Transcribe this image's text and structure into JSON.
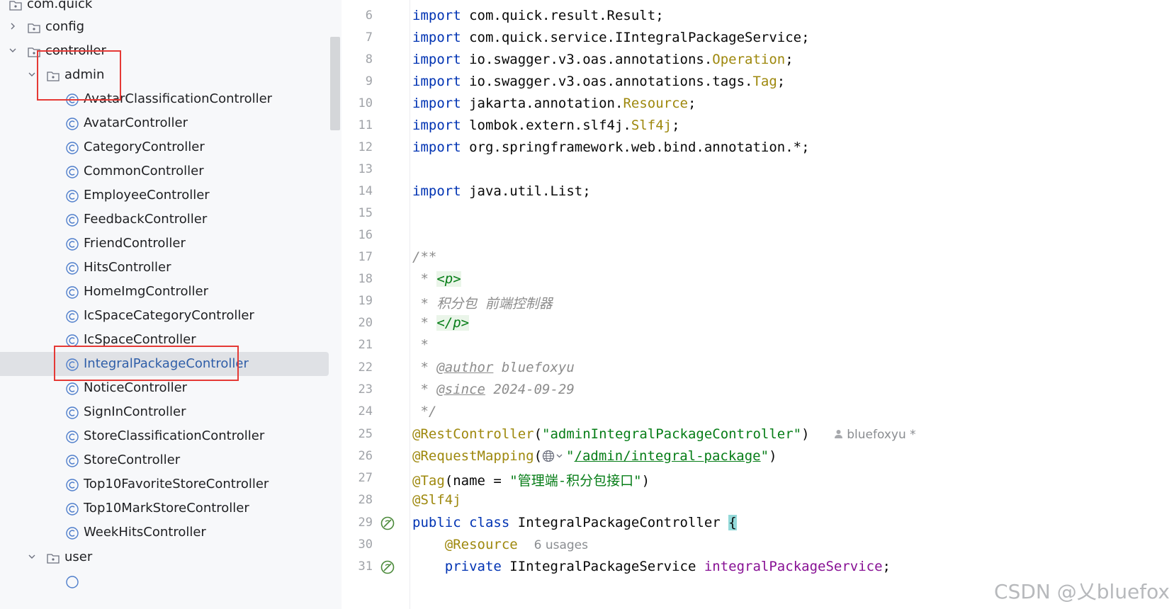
{
  "tree": {
    "rows": [
      {
        "label": "com.quick"
      },
      {
        "label": "config"
      },
      {
        "label": "controller"
      },
      {
        "label": "admin"
      },
      {
        "label": "AvatarClassificationController"
      },
      {
        "label": "AvatarController"
      },
      {
        "label": "CategoryController"
      },
      {
        "label": "CommonController"
      },
      {
        "label": "EmployeeController"
      },
      {
        "label": "FeedbackController"
      },
      {
        "label": "FriendController"
      },
      {
        "label": "HitsController"
      },
      {
        "label": "HomeImgController"
      },
      {
        "label": "IcSpaceCategoryController"
      },
      {
        "label": "IcSpaceController"
      },
      {
        "label": "IntegralPackageController"
      },
      {
        "label": "NoticeController"
      },
      {
        "label": "SignInController"
      },
      {
        "label": "StoreClassificationController"
      },
      {
        "label": "StoreController"
      },
      {
        "label": "Top10FavoriteStoreController"
      },
      {
        "label": "Top10MarkStoreController"
      },
      {
        "label": "WeekHitsController"
      },
      {
        "label": "user"
      }
    ],
    "selected_label": "IntegralPackageController"
  },
  "editor": {
    "line_numbers": [
      "6",
      "7",
      "8",
      "9",
      "10",
      "11",
      "12",
      "13",
      "14",
      "15",
      "16",
      "17",
      "18",
      "19",
      "20",
      "21",
      "22",
      "23",
      "24",
      "25",
      "26",
      "27",
      "28",
      "29",
      "30",
      "31"
    ],
    "kw_import": "import",
    "l6": "com.quick.result.Result;",
    "l7": "com.quick.service.IIntegralPackageService;",
    "l8_pre": "io.swagger.v3.oas.annotations.",
    "l8_cls": "Operation",
    "l9_pre": "io.swagger.v3.oas.annotations.tags.",
    "l9_cls": "Tag",
    "l10_pre": "jakarta.annotation.",
    "l10_cls": "Resource",
    "l11_pre": "lombok.extern.slf4j.",
    "l11_cls": "Slf4j",
    "l12": "org.springframework.web.bind.annotation.*;",
    "l14": "java.util.List;",
    "l17": "/**",
    "star": " * ",
    "p_open": "<p>",
    "l19_text": "积分包 前端控制器",
    "p_close": "</p>",
    "l21": " *",
    "author_tag": "@author",
    "author_val": " bluefoxyu",
    "since_tag": "@since",
    "since_val": " 2024-09-29",
    "l24": " */",
    "l25_ann": "@RestController",
    "l25_str": "\"adminIntegralPackageController\"",
    "l25_author": "bluefoxyu *",
    "l26_ann": "@RequestMapping",
    "l26_path": "/admin/integral-package",
    "l27_ann": "@Tag",
    "l27_name": "name = ",
    "l27_str": "\"管理端-积分包接口\"",
    "l28_ann": "@Slf4j",
    "l29_public": "public",
    "l29_class": "class",
    "l29_name": "IntegralPackageController",
    "l29_brace": "{",
    "l30_ann": "@Resource",
    "l30_usages": "6 usages",
    "l31_private": "private",
    "l31_type": "IIntegralPackageService",
    "l31_field": "integralPackageService"
  },
  "watermark": "CSDN @乂bluefox",
  "colors": {
    "keyword": "#0033b3",
    "annotation": "#9e880d",
    "string": "#067d17",
    "highlight_box": "#e53935"
  }
}
